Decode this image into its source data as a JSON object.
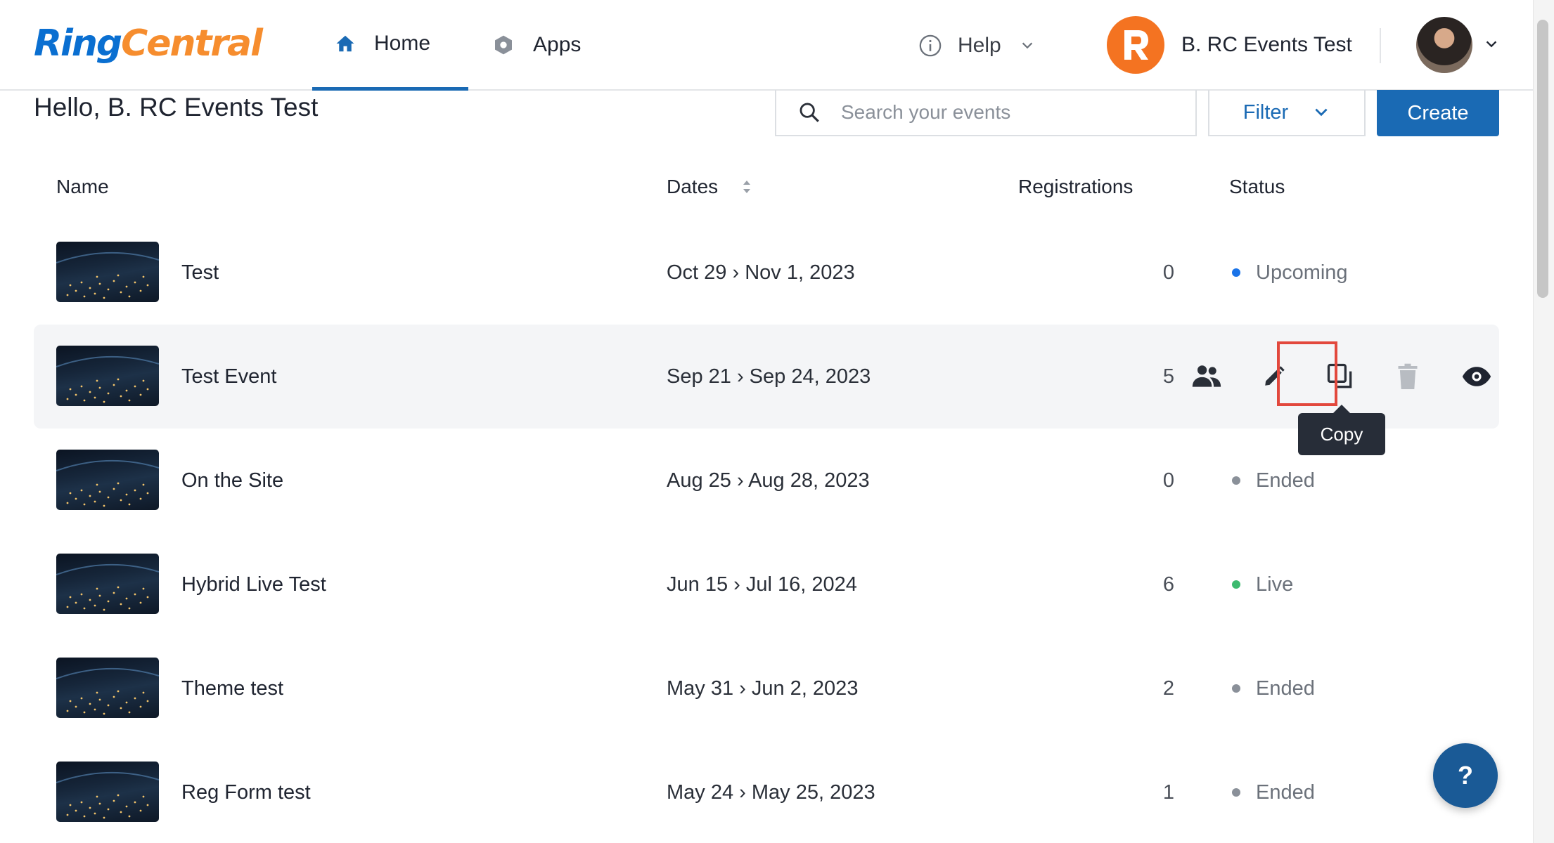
{
  "nav": {
    "logo_ring": "Ring",
    "logo_central": "Central",
    "home_label": "Home",
    "apps_label": "Apps",
    "help_label": "Help",
    "account_name": "B. RC Events Test"
  },
  "header": {
    "greeting": "Hello, B. RC Events Test",
    "search_placeholder": "Search your events",
    "filter_label": "Filter",
    "create_label": "Create"
  },
  "table": {
    "columns": {
      "name": "Name",
      "dates": "Dates",
      "registrations": "Registrations",
      "status": "Status"
    },
    "rows": [
      {
        "name": "Test",
        "dates": "Oct 29 › Nov 1, 2023",
        "registrations": "0",
        "status": "Upcoming",
        "status_color": "#1a73e8"
      },
      {
        "name": "Test Event",
        "dates": "Sep 21 › Sep 24, 2023",
        "registrations": "5",
        "status": "",
        "status_color": ""
      },
      {
        "name": "On the Site",
        "dates": "Aug 25 › Aug 28, 2023",
        "registrations": "0",
        "status": "Ended",
        "status_color": "#8a9099"
      },
      {
        "name": "Hybrid Live Test",
        "dates": "Jun 15 › Jul 16, 2024",
        "registrations": "6",
        "status": "Live",
        "status_color": "#3dba6f"
      },
      {
        "name": "Theme test",
        "dates": "May 31 › Jun 2, 2023",
        "registrations": "2",
        "status": "Ended",
        "status_color": "#8a9099"
      },
      {
        "name": "Reg Form test",
        "dates": "May 24 › May 25, 2023",
        "registrations": "1",
        "status": "Ended",
        "status_color": "#8a9099"
      }
    ]
  },
  "tooltip": {
    "copy": "Copy"
  },
  "fab": {
    "label": "?"
  },
  "colors": {
    "brand_blue": "#1a6ab4",
    "brand_orange": "#f47321",
    "highlight_red": "#e2483d"
  }
}
